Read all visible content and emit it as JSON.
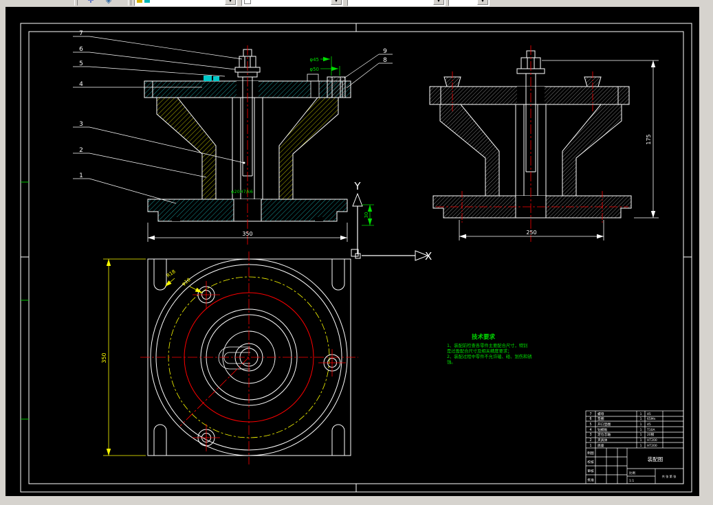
{
  "colors": {
    "canvas": "#000000",
    "chrome": "#d6d3ce",
    "line": "#ffffff",
    "centerline": "#ff0000",
    "dims_green": "#00dd00",
    "dims_yellow": "#ffff00",
    "hatch_teal": "#18a6a6",
    "hatch_yellow": "#cccc00"
  },
  "toolbar": {
    "layer_combo_value": "",
    "color_combo_value": "",
    "linetype_combo_value": "",
    "lineweight_combo_value": "",
    "dropdown_glyph": "▼"
  },
  "drawing": {
    "callouts": {
      "left": [
        "7",
        "6",
        "5",
        "4",
        "3",
        "2",
        "1"
      ],
      "right": [
        "9",
        "8"
      ]
    },
    "dims": {
      "phi45": "φ45",
      "phi50": "φ50",
      "front_width": "350",
      "side_width": "250",
      "side_height": "175",
      "ucs_offset": "30",
      "plan_height": "350",
      "fit": "φ20H7/k6",
      "plan_radius": "R18",
      "plan_hole": "φ18"
    },
    "axes": {
      "x": "X",
      "y": "Y"
    },
    "tech": {
      "title": "技术要求",
      "line1": "1、装配前检查各零件主要配合尺寸，特别",
      "line2": "是过盈配合尺寸及相关精度要求；",
      "line3": "2、装配过程中零件不允许磕、碰、划伤和锈",
      "line4": "蚀。"
    },
    "titleblock": {
      "bom": [
        {
          "no": "7",
          "name": "螺母",
          "qty": "1",
          "mat": "45"
        },
        {
          "no": "6",
          "name": "垫圈",
          "qty": "1",
          "mat": "65Mn"
        },
        {
          "no": "5",
          "name": "开口垫圈",
          "qty": "1",
          "mat": "45"
        },
        {
          "no": "4",
          "name": "钻模板",
          "qty": "1",
          "mat": "T10A"
        },
        {
          "no": "3",
          "name": "定位芯轴",
          "qty": "1",
          "mat": "20钢"
        },
        {
          "no": "2",
          "name": "夹具体",
          "qty": "1",
          "mat": "HT200"
        },
        {
          "no": "1",
          "name": "底座",
          "qty": "1",
          "mat": "HT200"
        }
      ],
      "sign_rows": [
        "制图",
        "校核",
        "审核",
        "批准"
      ],
      "title": "装配图",
      "scale_label": "比例",
      "scale": "1:1",
      "sheet": "共 张 第 张"
    }
  }
}
